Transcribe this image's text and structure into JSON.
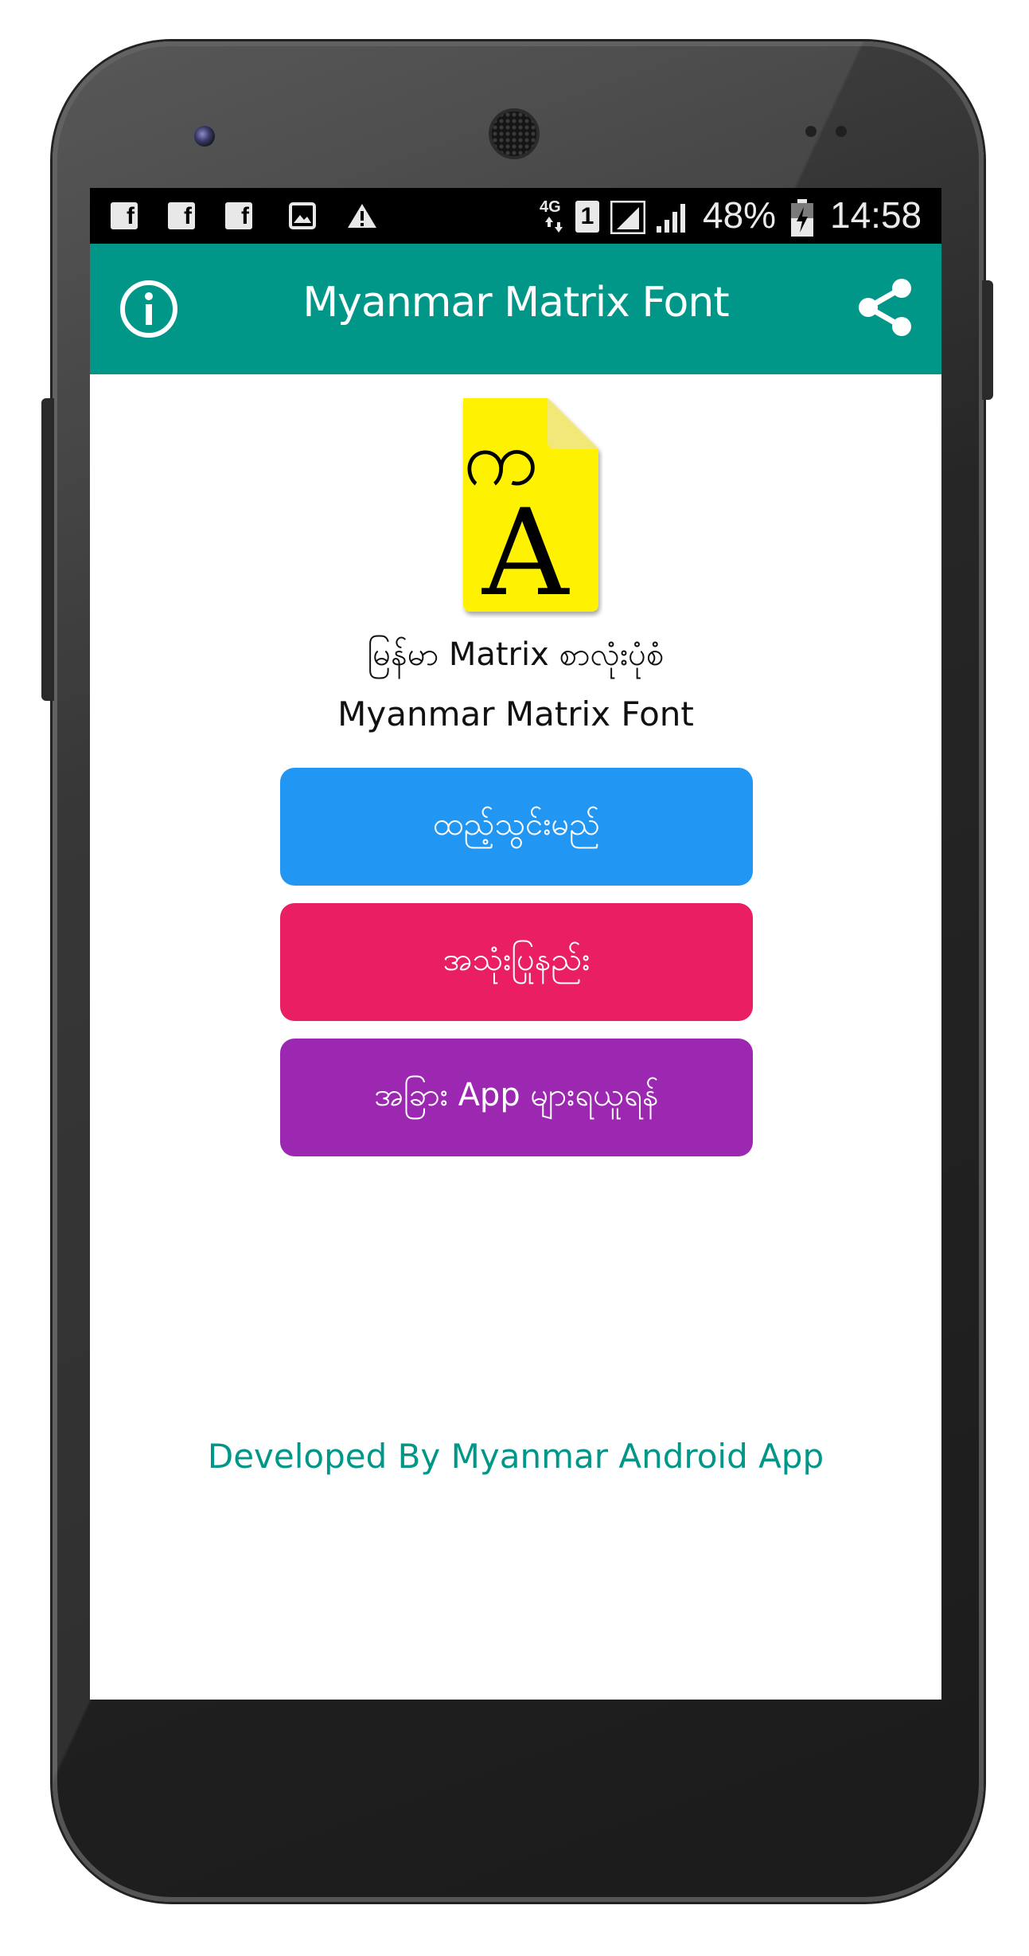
{
  "status_bar": {
    "notification_icons": [
      "facebook-icon",
      "facebook-icon",
      "facebook-icon",
      "image-icon",
      "warning-icon"
    ],
    "network": "4G",
    "sim": "1",
    "battery": "48%",
    "time": "14:58"
  },
  "app_bar": {
    "title": "Myanmar Matrix Font",
    "left_icon": "info-icon",
    "right_icon": "share-icon"
  },
  "content": {
    "logo": {
      "glyph_top": "က",
      "glyph_bottom": "A",
      "color": "#fff200"
    },
    "title_myanmar": "မြန်မာ Matrix စာလုံးပုံစံ",
    "title_english": "Myanmar Matrix Font",
    "buttons": [
      {
        "label": "ထည့်သွင်းမည်",
        "color": "#2196f3"
      },
      {
        "label": "အသုံးပြုနည်း",
        "color": "#e91e63"
      },
      {
        "label": "အခြား App များရယူရန်",
        "color": "#9c27b0"
      }
    ]
  },
  "footer": {
    "text": "Developed By Myanmar Android App",
    "color": "#009688"
  },
  "colors": {
    "app_bar": "#009688",
    "status_bar": "#000000"
  }
}
